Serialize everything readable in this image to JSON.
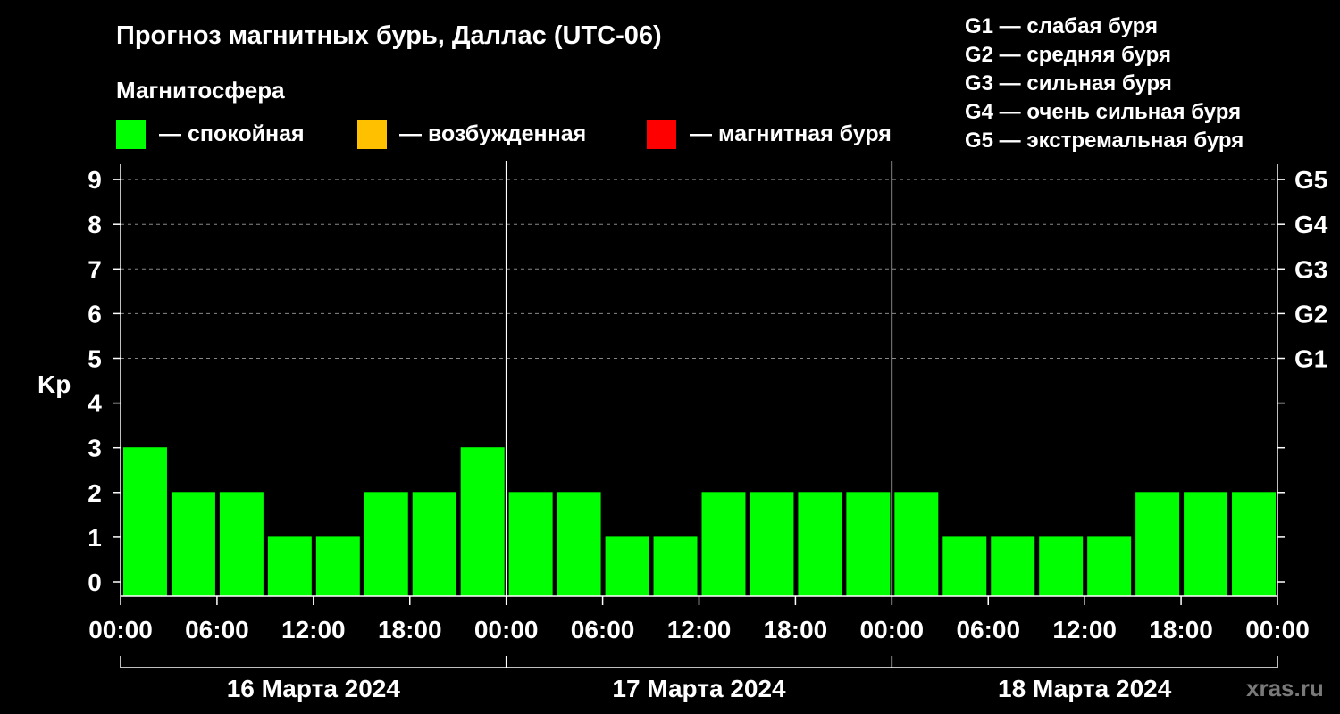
{
  "title": "Прогноз магнитных бурь, Даллас (UTC-06)",
  "legend": {
    "heading": "Магнитосфера",
    "items": [
      {
        "color": "#00FF00",
        "label": "— спокойная"
      },
      {
        "color": "#FFC000",
        "label": "— возбужденная"
      },
      {
        "color": "#FF0000",
        "label": "— магнитная буря"
      }
    ]
  },
  "g_scale": [
    "G1 — слабая буря",
    "G2 — средняя буря",
    "G3 — сильная буря",
    "G4 — очень сильная буря",
    "G5 — экстремальная буря"
  ],
  "watermark": "xras.ru",
  "chart_data": {
    "type": "bar",
    "ylabel": "Kp",
    "ylim": [
      0,
      9
    ],
    "yticks": [
      "0",
      "1",
      "2",
      "3",
      "4",
      "5",
      "6",
      "7",
      "8",
      "9"
    ],
    "right_ticks": [
      {
        "kp": 5,
        "label": "G1"
      },
      {
        "kp": 6,
        "label": "G2"
      },
      {
        "kp": 7,
        "label": "G3"
      },
      {
        "kp": 8,
        "label": "G4"
      },
      {
        "kp": 9,
        "label": "G5"
      }
    ],
    "grid": "dashed, Kp 5–9",
    "x_tick_labels": [
      "00:00",
      "06:00",
      "12:00",
      "18:00",
      "00:00",
      "06:00",
      "12:00",
      "18:00",
      "00:00",
      "06:00",
      "12:00",
      "18:00",
      "00:00"
    ],
    "days": [
      "16 Марта 2024",
      "17 Марта 2024",
      "18 Марта 2024"
    ],
    "interval_hours": 3,
    "bar_color": "#00FF00",
    "values": [
      3,
      2,
      2,
      1,
      1,
      2,
      2,
      3,
      2,
      2,
      1,
      1,
      2,
      2,
      2,
      2,
      2,
      1,
      1,
      1,
      1,
      2,
      2,
      2
    ]
  }
}
